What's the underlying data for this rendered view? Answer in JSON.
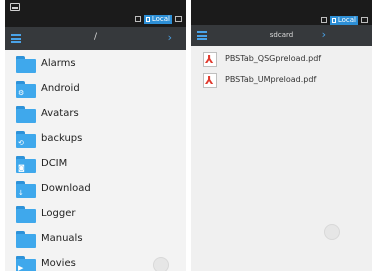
{
  "colors": {
    "accent": "#2d8fd6",
    "appbar": "#36393c",
    "statusbar": "#1b1b1b",
    "folder": "#3fa8ec",
    "pdf_red": "#e03a2e"
  },
  "left": {
    "status": {
      "storage_label": "Local"
    },
    "appbar": {
      "path": "/",
      "menu_icon": "menu-icon",
      "chevron": "›"
    },
    "folders": [
      {
        "name": "Alarms",
        "icon": "folder-icon",
        "glyph": ""
      },
      {
        "name": "Android",
        "icon": "folder-settings-icon",
        "glyph": "⚙"
      },
      {
        "name": "Avatars",
        "icon": "folder-icon",
        "glyph": ""
      },
      {
        "name": "backups",
        "icon": "folder-backup-icon",
        "glyph": "⟲"
      },
      {
        "name": "DCIM",
        "icon": "folder-camera-icon",
        "glyph": "◙"
      },
      {
        "name": "Download",
        "icon": "folder-download-icon",
        "glyph": "↓"
      },
      {
        "name": "Logger",
        "icon": "folder-icon",
        "glyph": ""
      },
      {
        "name": "Manuals",
        "icon": "folder-icon",
        "glyph": ""
      },
      {
        "name": "Movies",
        "icon": "folder-movie-icon",
        "glyph": "▶"
      }
    ]
  },
  "right": {
    "status": {
      "storage_label": "Local"
    },
    "appbar": {
      "path": "sdcard",
      "menu_icon": "menu-icon",
      "chevron": "›"
    },
    "files": [
      {
        "name": "PBSTab_QSGpreload.pdf",
        "icon": "pdf-file-icon"
      },
      {
        "name": "PBSTab_UMpreload.pdf",
        "icon": "pdf-file-icon"
      }
    ]
  }
}
